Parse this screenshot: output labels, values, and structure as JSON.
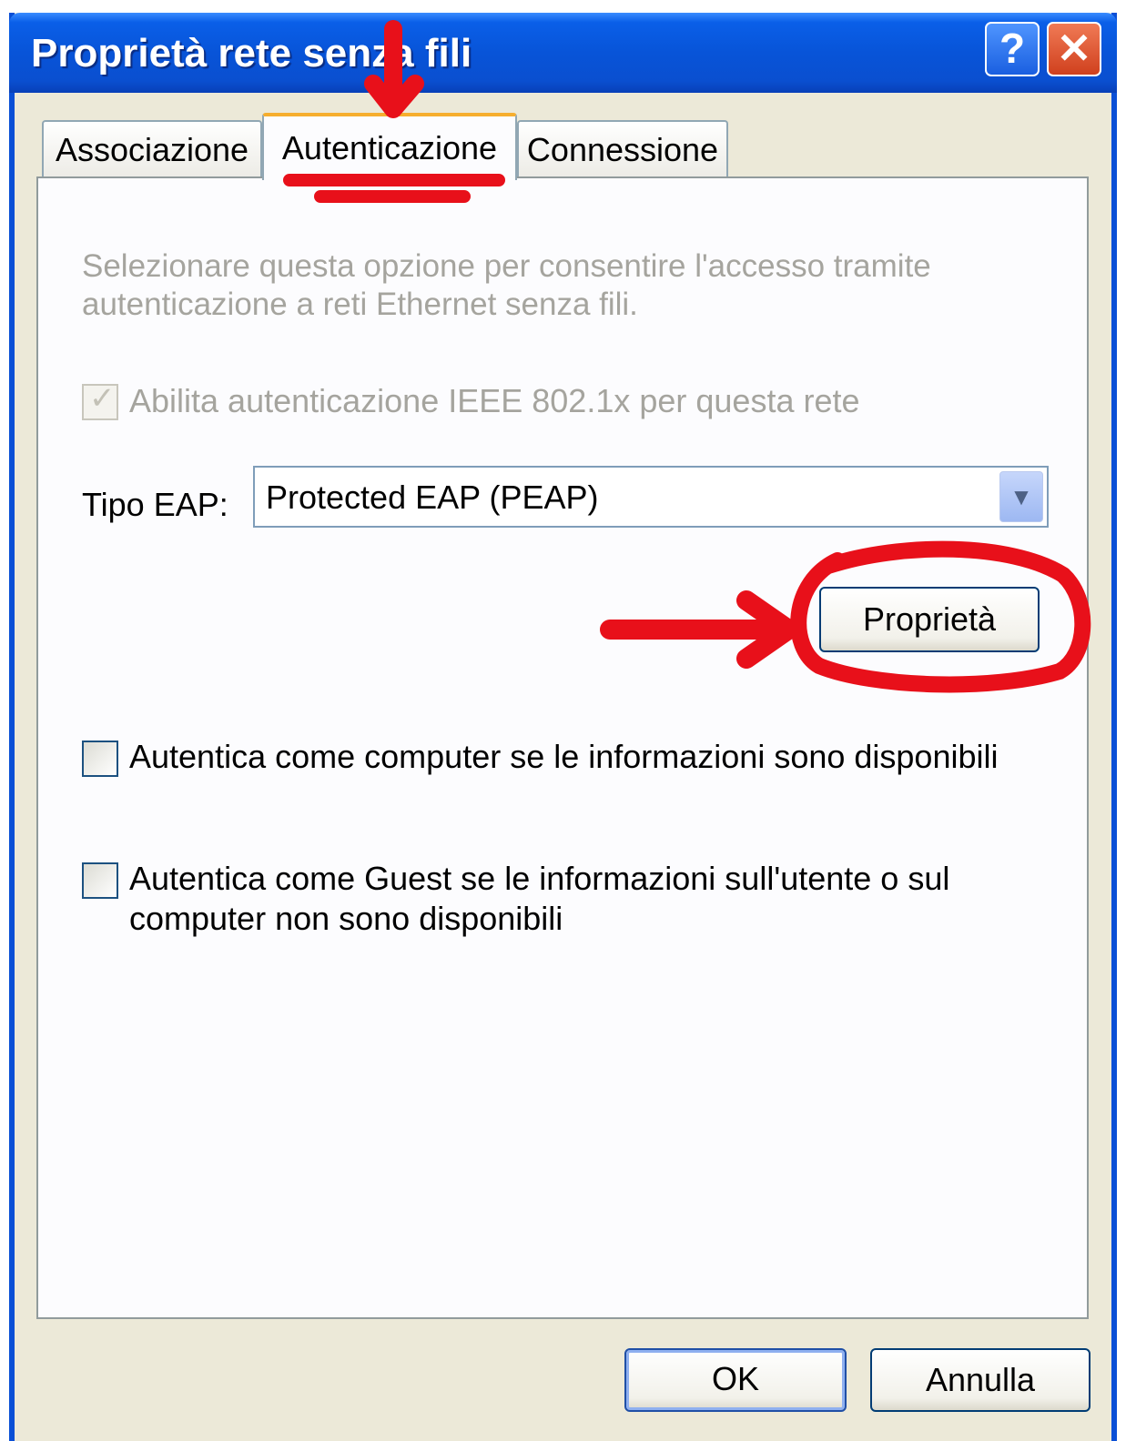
{
  "window": {
    "title": "Proprietà rete senza fili",
    "help_glyph": "?",
    "close_glyph": "✕"
  },
  "tabs": [
    {
      "label": "Associazione",
      "selected": false
    },
    {
      "label": "Autenticazione",
      "selected": true
    },
    {
      "label": "Connessione",
      "selected": false
    }
  ],
  "panel": {
    "description": "Selezionare questa opzione per consentire l'accesso tramite autenticazione a reti Ethernet senza fili.",
    "enable_8021x": {
      "label": "Abilita autenticazione IEEE 802.1x per questa rete",
      "checked": true,
      "disabled": true
    },
    "eap_type": {
      "label": "Tipo EAP:",
      "value": "Protected EAP (PEAP)"
    },
    "properties_button": "Proprietà",
    "auth_as_computer": {
      "label": "Autentica come computer se le informazioni sono disponibili",
      "checked": false
    },
    "auth_as_guest": {
      "label_line1": "Autentica come Guest se le informazioni sull'utente o sul",
      "label_line2": "computer non sono disponibili",
      "checked": false
    }
  },
  "footer": {
    "ok_label": "OK",
    "cancel_label": "Annulla"
  },
  "annotation_color": "#e8101a",
  "icons": {
    "dropdown": "chevron-down-icon",
    "check": "checkmark-icon"
  }
}
